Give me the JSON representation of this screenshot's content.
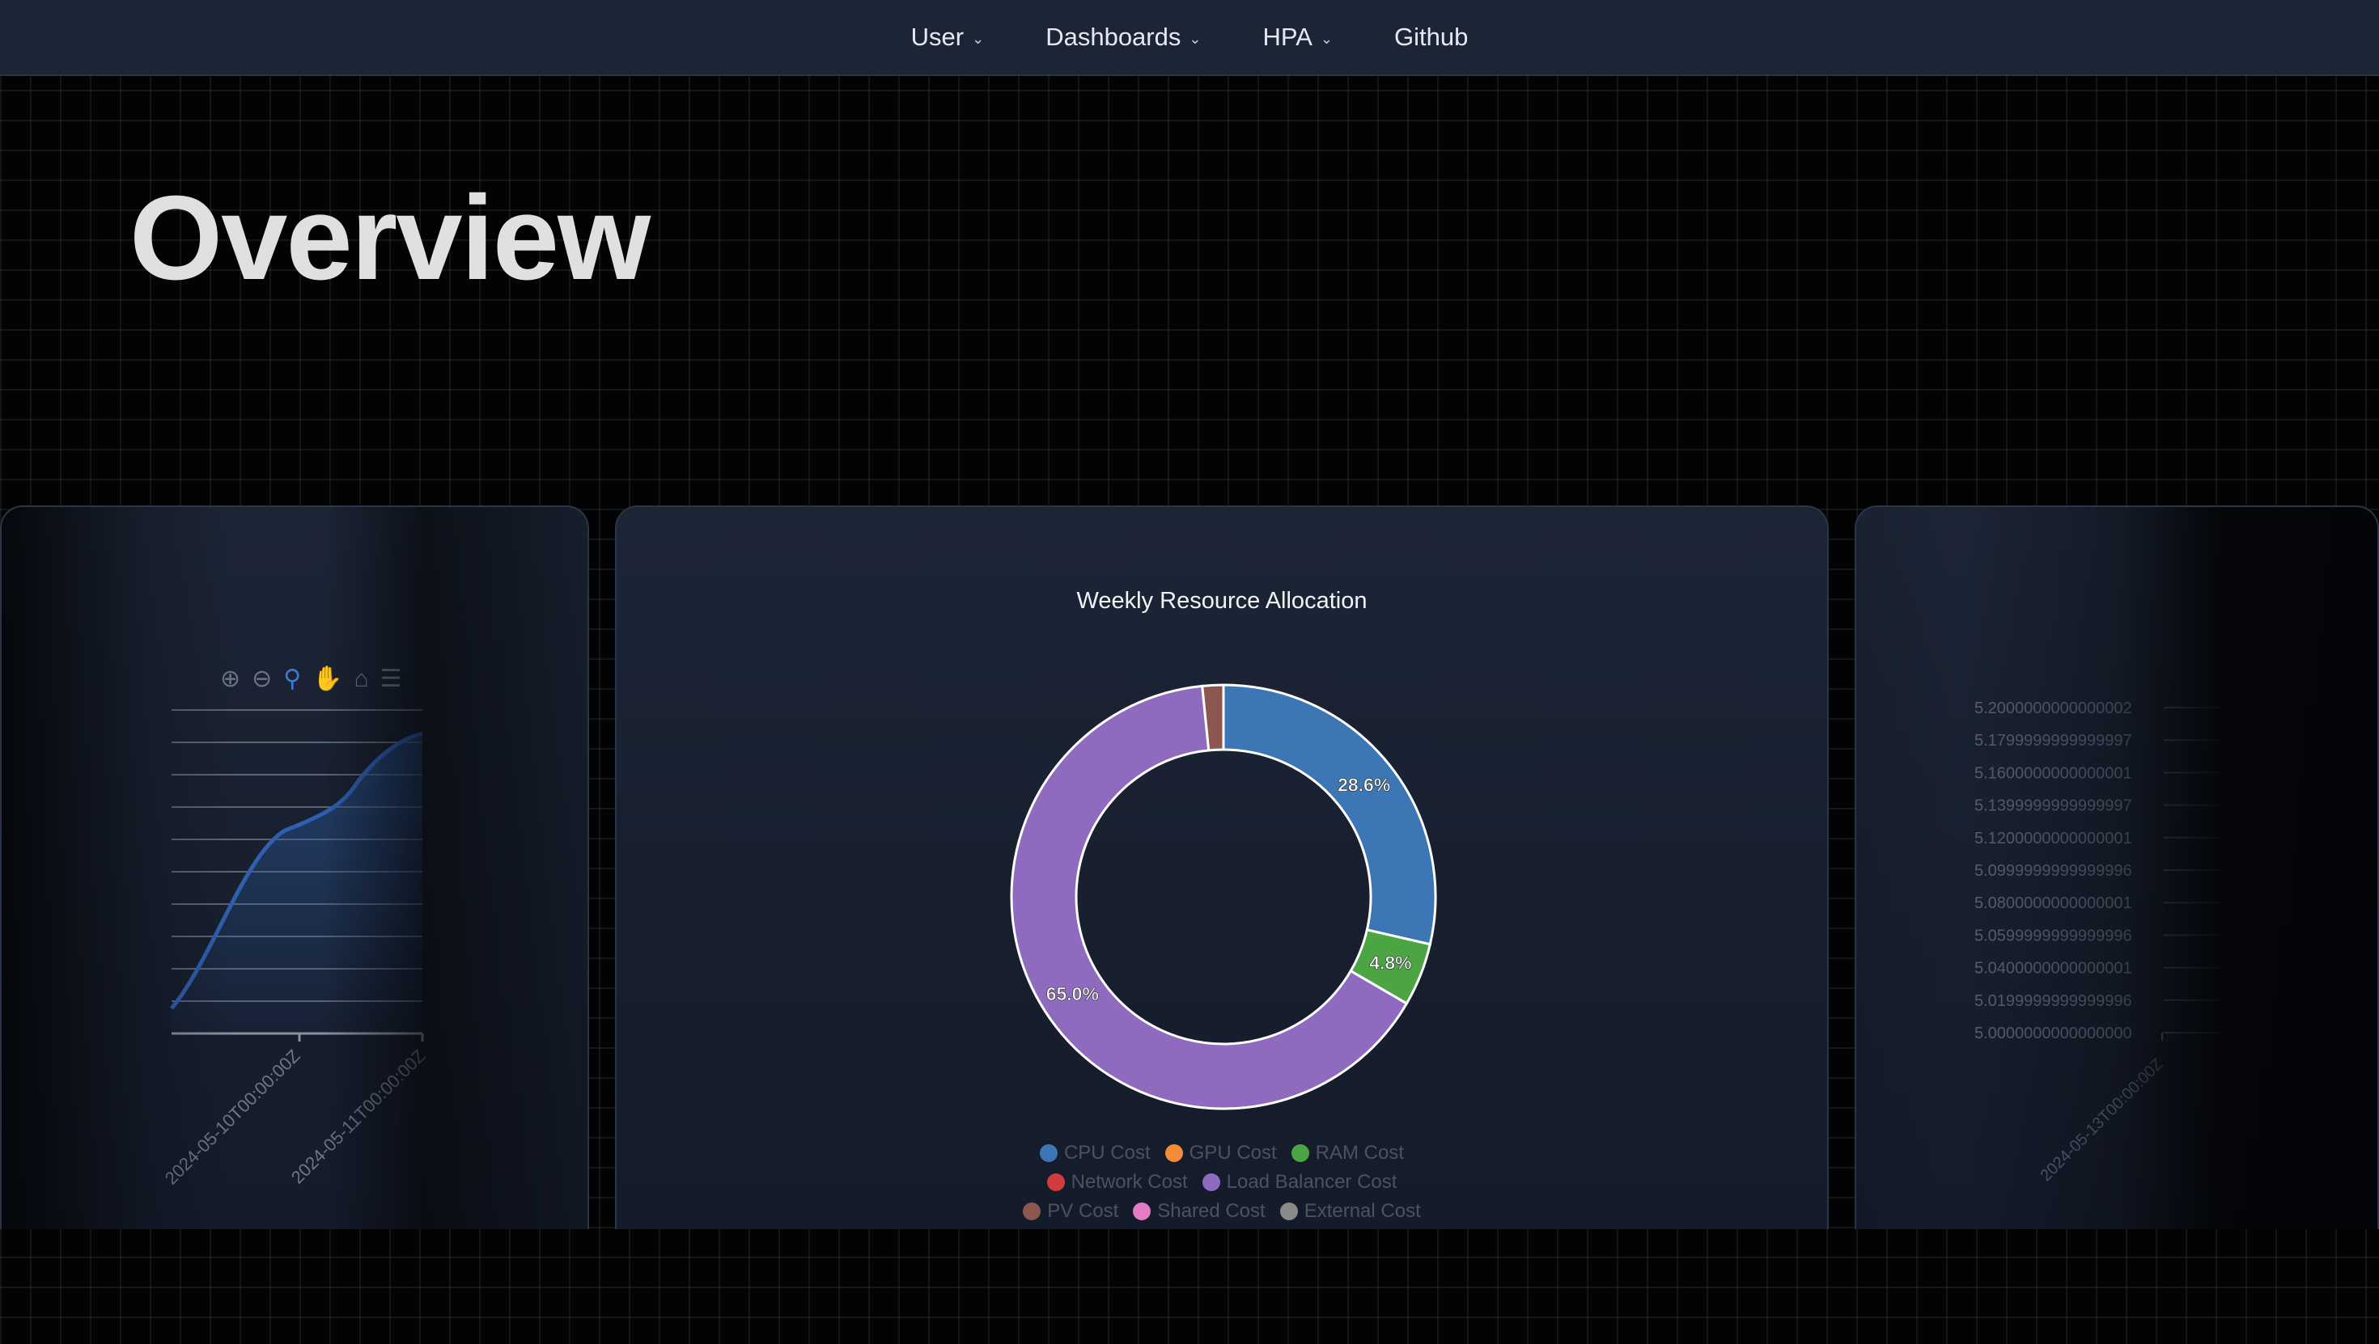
{
  "nav": {
    "items": [
      {
        "label": "User",
        "dropdown": true
      },
      {
        "label": "Dashboards",
        "dropdown": true
      },
      {
        "label": "HPA",
        "dropdown": true
      },
      {
        "label": "Github",
        "dropdown": false
      }
    ]
  },
  "page": {
    "title": "Overview"
  },
  "left_card": {
    "toolbar_icons": [
      "zoom-in-icon",
      "zoom-out-icon",
      "selection-zoom-icon",
      "pan-icon",
      "home-icon",
      "menu-icon"
    ],
    "x_ticks": [
      "2024-05-10T00:00:00Z",
      "2024-05-11T00:00:00Z"
    ]
  },
  "right_card": {
    "y_ticks": [
      "5.2000000000000002",
      "5.1799999999999997",
      "5.1600000000000001",
      "5.1399999999999997",
      "5.1200000000000001",
      "5.0999999999999996",
      "5.0800000000000001",
      "5.0599999999999996",
      "5.0400000000000001",
      "5.0199999999999996",
      "5.0000000000000000"
    ],
    "x_ticks": [
      "2024-05-13T00:00:00Z"
    ]
  },
  "chart_data": {
    "type": "pie",
    "title": "Weekly Resource Allocation",
    "categories": [
      "CPU Cost",
      "GPU Cost",
      "RAM Cost",
      "Network Cost",
      "Load Balancer Cost",
      "PV Cost",
      "Shared Cost",
      "External Cost"
    ],
    "values": [
      28.6,
      0,
      4.8,
      0,
      65.0,
      1.6,
      0,
      0
    ],
    "labels_shown": [
      "28.6%",
      "",
      "4.8%",
      "",
      "65.0%",
      "",
      "",
      ""
    ],
    "colors": [
      "#3d76b5",
      "#f28c38",
      "#4ca543",
      "#d03c3c",
      "#8e6bbf",
      "#8c574f",
      "#e47cc3",
      "#8a8a8a"
    ],
    "legend_rows": [
      [
        0,
        1,
        2
      ],
      [
        3,
        4
      ],
      [
        5,
        6,
        7
      ]
    ],
    "donut": true,
    "legend_position": "bottom"
  }
}
